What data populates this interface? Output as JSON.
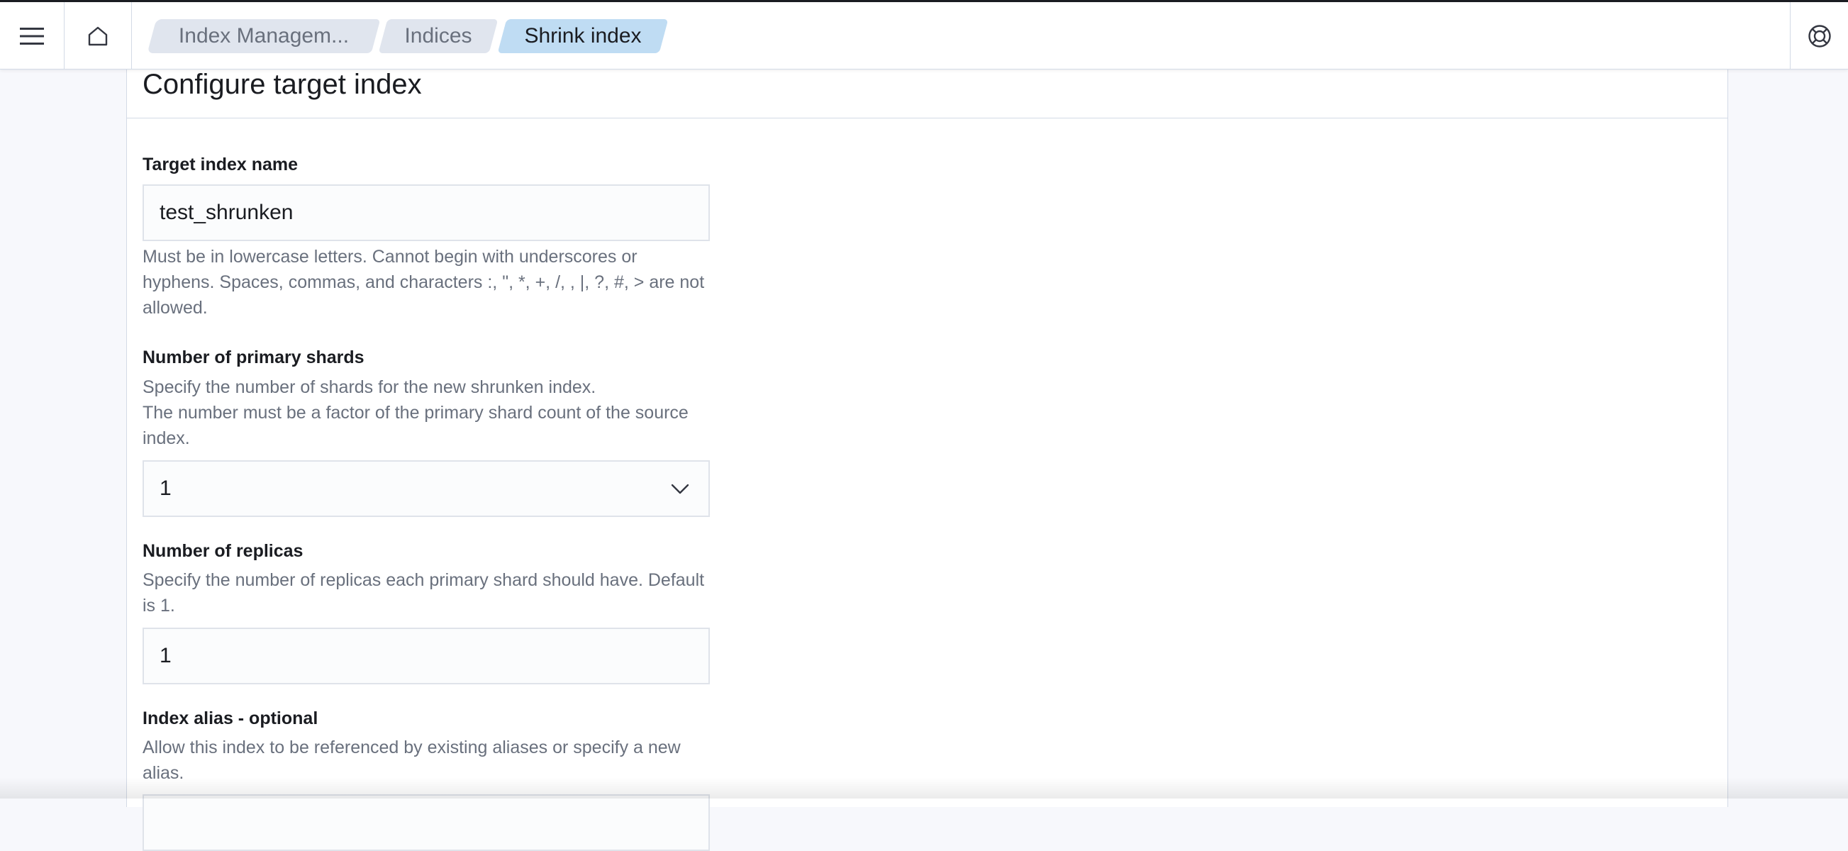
{
  "header": {
    "menu_icon": "hamburger-menu-icon",
    "home_icon": "home-icon",
    "help_icon": "lifebuoy-help-icon",
    "breadcrumbs": [
      {
        "label": "Index Managem..."
      },
      {
        "label": "Indices"
      },
      {
        "label": "Shrink index"
      }
    ]
  },
  "panel": {
    "title": "Configure target index",
    "target_name": {
      "label": "Target index name",
      "value": "test_shrunken",
      "help_lines": [
        "Must be in lowercase letters. Cannot begin with underscores or",
        "hyphens. Spaces, commas, and characters :, \", *, +, /, , |, ?, #, > are not",
        "allowed."
      ]
    },
    "primary_shards": {
      "label": "Number of primary shards",
      "help_lines": [
        "Specify the number of shards for the new shrunken index.",
        "The number must be a factor of the primary shard count of the source",
        "index."
      ],
      "selected": "1",
      "chevron_icon": "chevron-down-icon"
    },
    "replicas": {
      "label": "Number of replicas",
      "help_lines": [
        "Specify the number of replicas each primary shard should have. Default",
        "is 1."
      ],
      "value": "1"
    },
    "alias": {
      "label": "Index alias - optional",
      "help_lines": [
        "Allow this index to be referenced by existing aliases or specify a new",
        "alias."
      ]
    }
  },
  "colors": {
    "breadcrumb_current": "#bfdcf3",
    "breadcrumb_default": "#e0e5ee",
    "help_text": "#69707d"
  }
}
